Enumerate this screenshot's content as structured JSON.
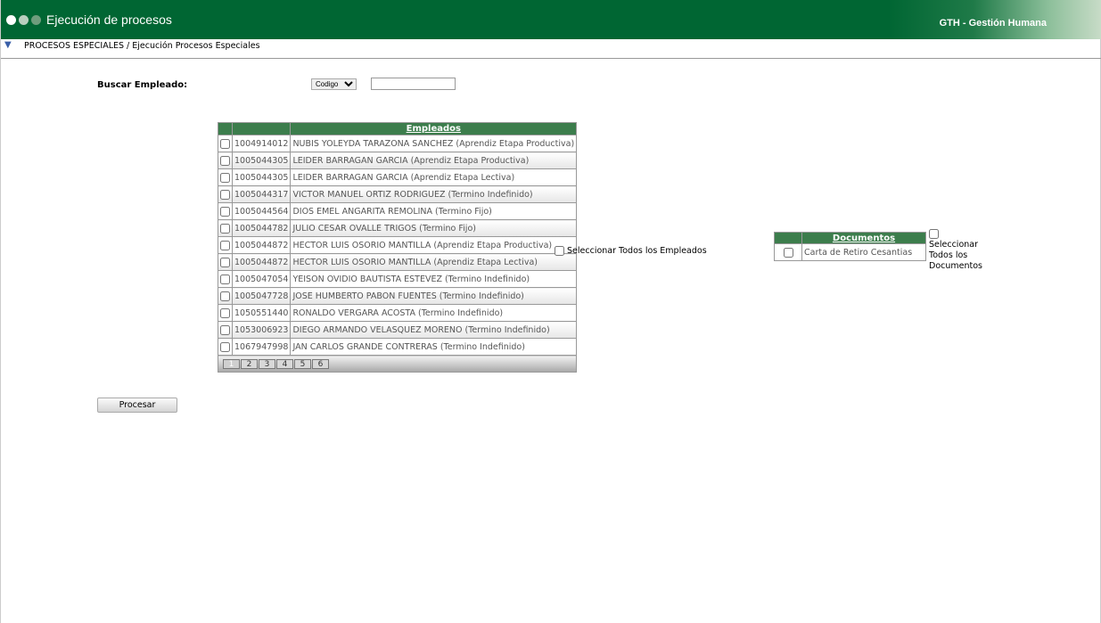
{
  "header": {
    "title": "Ejecución de procesos",
    "brand": "GTH - Gestión Humana",
    "dot_colors": [
      "#ffffff",
      "#b9cfbf",
      "#6f9d7d"
    ]
  },
  "breadcrumb": "PROCESOS ESPECIALES / Ejecución Procesos Especiales",
  "search": {
    "label": "Buscar Empleado:",
    "type_selected": "Codigo",
    "value": ""
  },
  "employees": {
    "header": "Empleados",
    "rows": [
      {
        "code": "1004914012",
        "name": "NUBIS YOLEYDA TARAZONA SANCHEZ (Aprendiz Etapa Productiva)"
      },
      {
        "code": "1005044305",
        "name": "LEIDER BARRAGAN GARCIA (Aprendiz Etapa Productiva)"
      },
      {
        "code": "1005044305",
        "name": "LEIDER BARRAGAN GARCIA (Aprendiz Etapa Lectiva)"
      },
      {
        "code": "1005044317",
        "name": "VICTOR MANUEL ORTIZ RODRIGUEZ (Termino Indefinido)"
      },
      {
        "code": "1005044564",
        "name": "DIOS EMEL ANGARITA REMOLINA (Termino Fijo)"
      },
      {
        "code": "1005044782",
        "name": "JULIO CESAR OVALLE TRIGOS (Termino Fijo)"
      },
      {
        "code": "1005044872",
        "name": "HECTOR LUIS OSORIO MANTILLA (Aprendiz Etapa Productiva)"
      },
      {
        "code": "1005044872",
        "name": "HECTOR LUIS OSORIO MANTILLA (Aprendiz Etapa Lectiva)"
      },
      {
        "code": "1005047054",
        "name": "YEISON OVIDIO BAUTISTA ESTEVEZ (Termino Indefinido)"
      },
      {
        "code": "1005047728",
        "name": "JOSE HUMBERTO PABON FUENTES (Termino Indefinido)"
      },
      {
        "code": "1050551440",
        "name": "RONALDO VERGARA ACOSTA (Termino Indefinido)"
      },
      {
        "code": "1053006923",
        "name": "DIEGO ARMANDO VELASQUEZ MORENO (Termino Indefinido)"
      },
      {
        "code": "1067947998",
        "name": "JAN CARLOS GRANDE CONTRERAS (Termino Indefinido)"
      }
    ],
    "pages": [
      "1",
      "2",
      "3",
      "4",
      "5",
      "6"
    ],
    "current_page": "1",
    "select_all": "Seleccionar Todos los Empleados"
  },
  "documents": {
    "header": "Documentos",
    "rows": [
      {
        "name": "Carta de Retiro Cesantias"
      }
    ],
    "select_all": "Seleccionar Todos los Documentos"
  },
  "process_button": "Procesar"
}
